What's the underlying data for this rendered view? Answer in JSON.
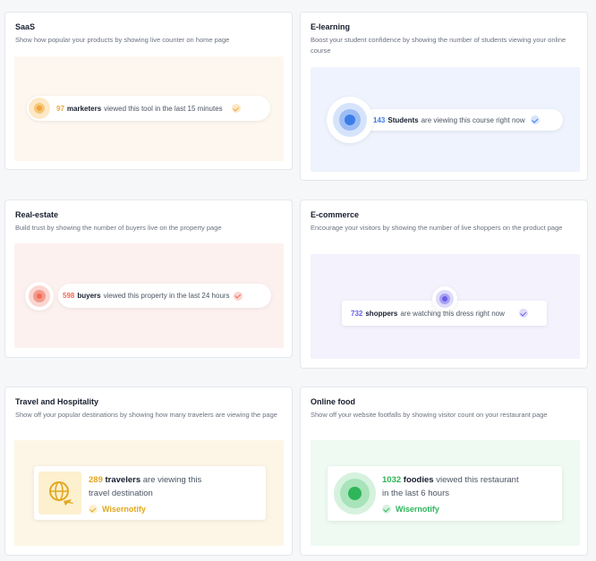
{
  "cards": [
    {
      "title": "SaaS",
      "desc": "Show how popular your products by showing live counter on home page",
      "count": "97",
      "noun": "marketers",
      "rest": "viewed this tool in the last 15 minutes",
      "accent": "#f0a43a",
      "bg": "#fdf7ef"
    },
    {
      "title": "E-learning",
      "desc": "Boost your student confidence by showing the number of students viewing your online course",
      "count": "143",
      "noun": "Students",
      "rest": "are viewing this course right now",
      "accent": "#3b7de8",
      "bg": "#eef3fd"
    },
    {
      "title": "Real-estate",
      "desc": "Build trust by showing the number of buyers live on the property page",
      "count": "598",
      "noun": "buyers",
      "rest": "viewed this property in the last 24 hours",
      "accent": "#ef6a57",
      "bg": "#fdf1ef"
    },
    {
      "title": "E-commerce",
      "desc": "Encourage your visitors by showing the number of live shoppers on the product page",
      "count": "732",
      "noun": "shoppers",
      "rest": "are watching this dress right now",
      "accent": "#6a5fe8",
      "bg": "#f3f2fd"
    },
    {
      "title": "Travel and Hospitality",
      "desc": "Show off your popular destinations by showing how many travelers are viewing the page",
      "count": "289",
      "noun": "travelers",
      "rest1": "are viewing this",
      "rest2": "travel destination",
      "brand": "Wisernotify",
      "accent": "#e2a820",
      "bg": "#fdf6e6"
    },
    {
      "title": "Online food",
      "desc": "Show off your website footfalls by showing visitor count on your restaurant page",
      "count": "1032",
      "noun": "foodies",
      "rest1": "viewed this restaurant",
      "rest2": "in the last 6 hours",
      "brand": "Wisernotify",
      "accent": "#2fb55a",
      "bg": "#eefaf2"
    }
  ],
  "icons": {
    "check": "check-circle-icon",
    "globe": "globe-plane-icon",
    "pulse": "live-pulse-icon"
  }
}
